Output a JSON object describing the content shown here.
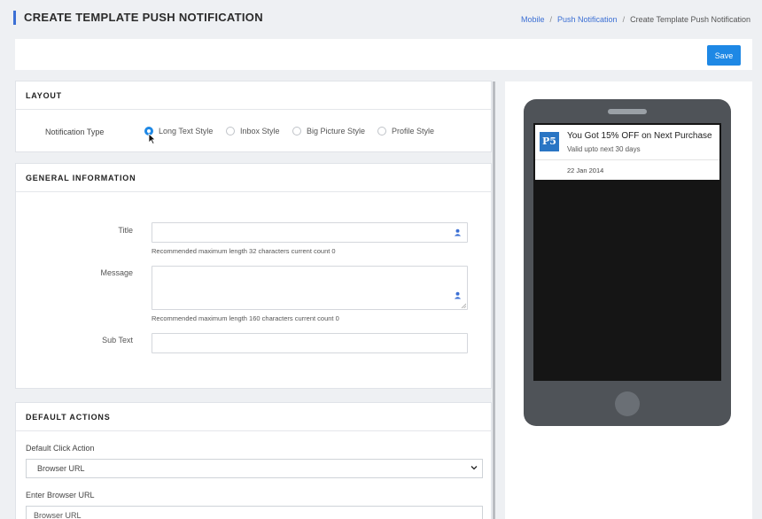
{
  "page": {
    "title": "CREATE TEMPLATE PUSH NOTIFICATION",
    "breadcrumb": [
      "Mobile",
      "Push Notification",
      "Create Template Push Notification"
    ]
  },
  "toolbar": {
    "save_label": "Save"
  },
  "layout_section": {
    "header": "LAYOUT",
    "notification_type_label": "Notification Type",
    "options": [
      "Long Text Style",
      "Inbox Style",
      "Big Picture Style",
      "Profile Style"
    ],
    "selected": "Long Text Style"
  },
  "general": {
    "header": "GENERAL INFORMATION",
    "title_label": "Title",
    "title_value": "",
    "title_hint": "Recommended maximum length 32 characters current count 0",
    "message_label": "Message",
    "message_value": "",
    "message_hint": "Recommended maximum length 160 characters current count 0",
    "subtext_label": "Sub Text",
    "subtext_value": ""
  },
  "default_actions": {
    "header": "DEFAULT ACTIONS",
    "click_action_label": "Default Click Action",
    "click_action_value": "Browser URL",
    "browser_url_label": "Enter Browser URL",
    "browser_url_placeholder": "Browser URL"
  },
  "preview": {
    "logo_text": "P5",
    "notif_title": "You Got 15% OFF on Next Purchase",
    "notif_sub": "Valid upto next 30 days",
    "notif_date": "22 Jan 2014"
  },
  "colors": {
    "accent": "#1e88e5",
    "phone_body": "#4f5358",
    "screen": "#151515"
  }
}
